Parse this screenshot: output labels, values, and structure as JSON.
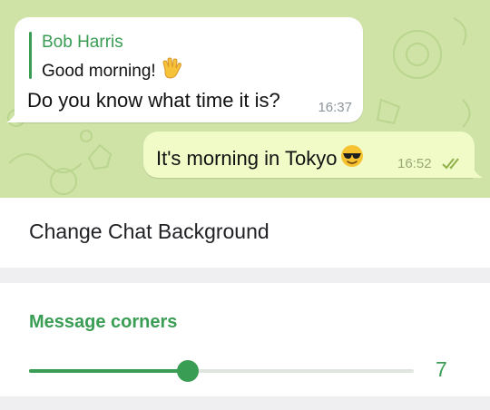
{
  "preview": {
    "incoming": {
      "reply_name": "Bob Harris",
      "reply_text": "Good morning!",
      "reply_emoji": "waving-hand",
      "text": "Do you know what time it is?",
      "time": "16:37"
    },
    "outgoing": {
      "text": "It's morning in Tokyo",
      "emoji": "sunglasses-face",
      "time": "16:52",
      "status": "read"
    }
  },
  "settings": {
    "change_background_label": "Change Chat Background",
    "message_corners": {
      "title": "Message corners",
      "value": "7",
      "min": 0,
      "max": 17,
      "current": 7
    }
  },
  "colors": {
    "accent": "#3a9d54",
    "chat_background": "#cfe3a7",
    "outgoing_bubble": "#f1fbc8"
  }
}
